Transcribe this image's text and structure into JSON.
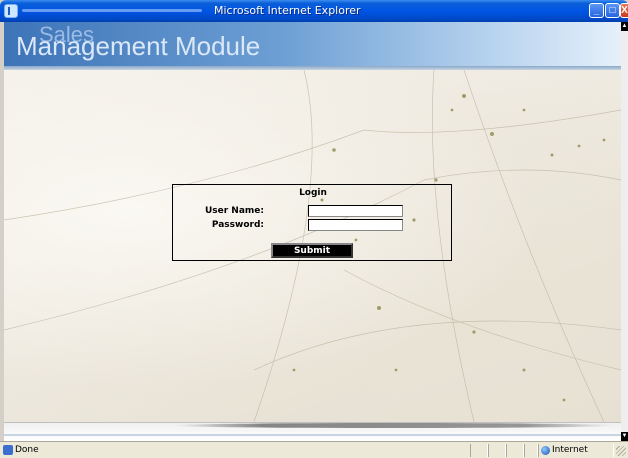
{
  "window": {
    "title": "Microsoft Internet Explorer"
  },
  "header": {
    "brand_small": "Sales",
    "brand_large": "Management Module"
  },
  "login": {
    "title": "Login",
    "username_label": "User Name:",
    "username_value": "",
    "password_label": "Password:",
    "password_value": "",
    "submit_label": "Submit"
  },
  "statusbar": {
    "status": "Done",
    "zone": "Internet"
  },
  "scrollbar": {
    "up_glyph": "▲",
    "down_glyph": "▼"
  },
  "window_buttons": {
    "minimize": "_",
    "maximize": "□",
    "close": "X"
  },
  "colors": {
    "titlebar": "#0055e5",
    "header_left": "#3d74b8",
    "header_right": "#e6f0fa",
    "submit_bg": "#000000",
    "statusbar": "#ece9d8"
  }
}
